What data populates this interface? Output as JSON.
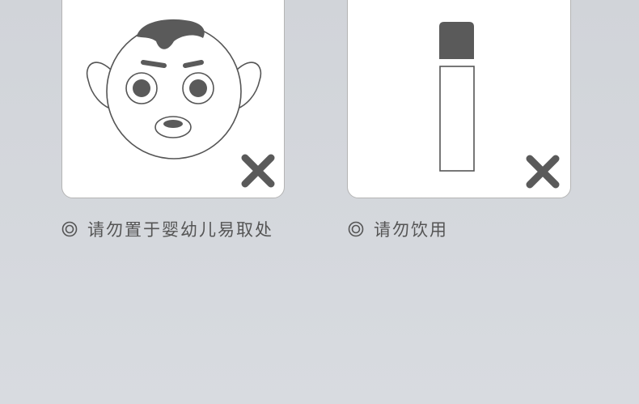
{
  "cards": [
    {
      "icon": "child-face-icon",
      "status_icon": "cross-icon",
      "caption": "请勿置于婴幼儿易取处"
    },
    {
      "icon": "bottle-icon",
      "status_icon": "cross-icon",
      "caption": "请勿饮用"
    }
  ],
  "colors": {
    "background": "#d3d6db",
    "card": "#ffffff",
    "icon_fill": "#5a5a5a",
    "text": "#555555"
  }
}
